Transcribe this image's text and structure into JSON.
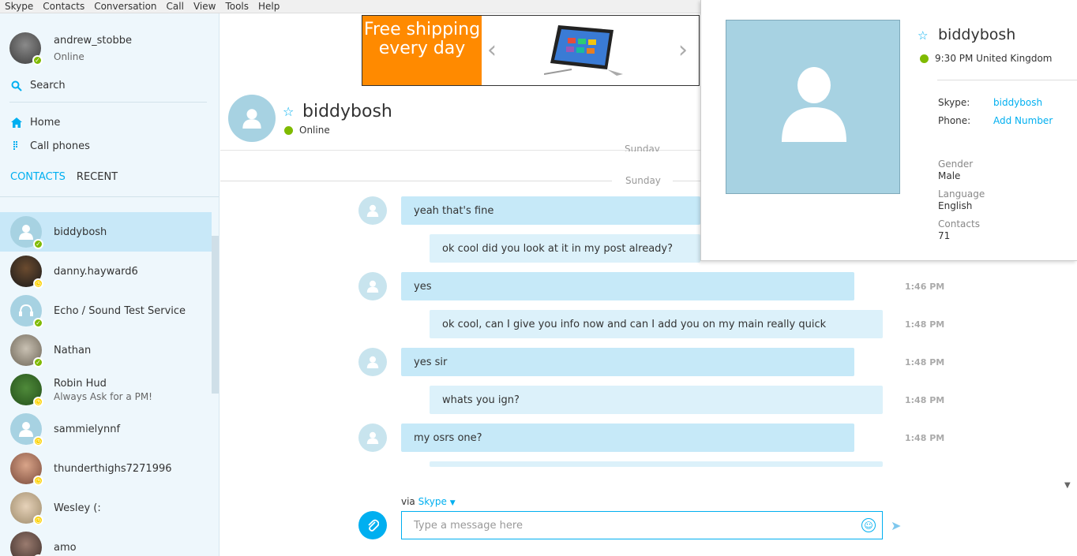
{
  "menu": [
    "Skype",
    "Contacts",
    "Conversation",
    "Call",
    "View",
    "Tools",
    "Help"
  ],
  "me": {
    "name": "andrew_stobbe",
    "status": "Online"
  },
  "sidebar": {
    "search_label": "Search",
    "home_label": "Home",
    "call_phones_label": "Call phones",
    "tab_contacts": "CONTACTS",
    "tab_recent": "RECENT"
  },
  "contacts": [
    {
      "name": "biddybosh",
      "mood": "",
      "status": "online"
    },
    {
      "name": "danny.hayward6",
      "mood": "",
      "status": "away"
    },
    {
      "name": "Echo / Sound Test Service",
      "mood": "",
      "status": "online"
    },
    {
      "name": "Nathan",
      "mood": "",
      "status": "online"
    },
    {
      "name": "Robin Hud",
      "mood": "Always Ask for a PM!",
      "status": "away"
    },
    {
      "name": "sammielynnf",
      "mood": "",
      "status": "away"
    },
    {
      "name": "thunderthighs7271996",
      "mood": "",
      "status": "away"
    },
    {
      "name": "Wesley (:",
      "mood": "",
      "status": "away"
    },
    {
      "name": "amo",
      "mood": "",
      "status": "away"
    }
  ],
  "banner": {
    "text": "Free shipping every day"
  },
  "conversation": {
    "name": "biddybosh",
    "status": "Online",
    "day_label_top": "Sunday",
    "day_label": "Sunday",
    "messages": [
      {
        "text": "yeah that's fine",
        "time": "",
        "from": "them"
      },
      {
        "text": "ok cool did you look at it in my post already?",
        "time": "",
        "from": "me"
      },
      {
        "text": "yes",
        "time": "1:46 PM",
        "from": "them"
      },
      {
        "text": "ok cool, can I give you info now and can I add you on my main really quick",
        "time": "1:48 PM",
        "from": "me"
      },
      {
        "text": "yes sir",
        "time": "1:48 PM",
        "from": "them"
      },
      {
        "text": "whats you ign?",
        "time": "1:48 PM",
        "from": "me"
      },
      {
        "text": "my osrs one?",
        "time": "1:48 PM",
        "from": "them"
      }
    ],
    "via_label": "via",
    "via_link": "Skype",
    "input_placeholder": "Type a message here"
  },
  "profile": {
    "name": "biddybosh",
    "local_time": "9:30 PM United Kingdom",
    "skype_label": "Skype:",
    "skype_value": "biddybosh",
    "phone_label": "Phone:",
    "phone_value": "Add Number",
    "gender_label": "Gender",
    "gender_value": "Male",
    "language_label": "Language",
    "language_value": "English",
    "contacts_label": "Contacts",
    "contacts_value": "71"
  },
  "colors": {
    "accent": "#00aff0",
    "online": "#7fba00",
    "away": "#fdd200",
    "bubble": "#c6e9f8"
  }
}
